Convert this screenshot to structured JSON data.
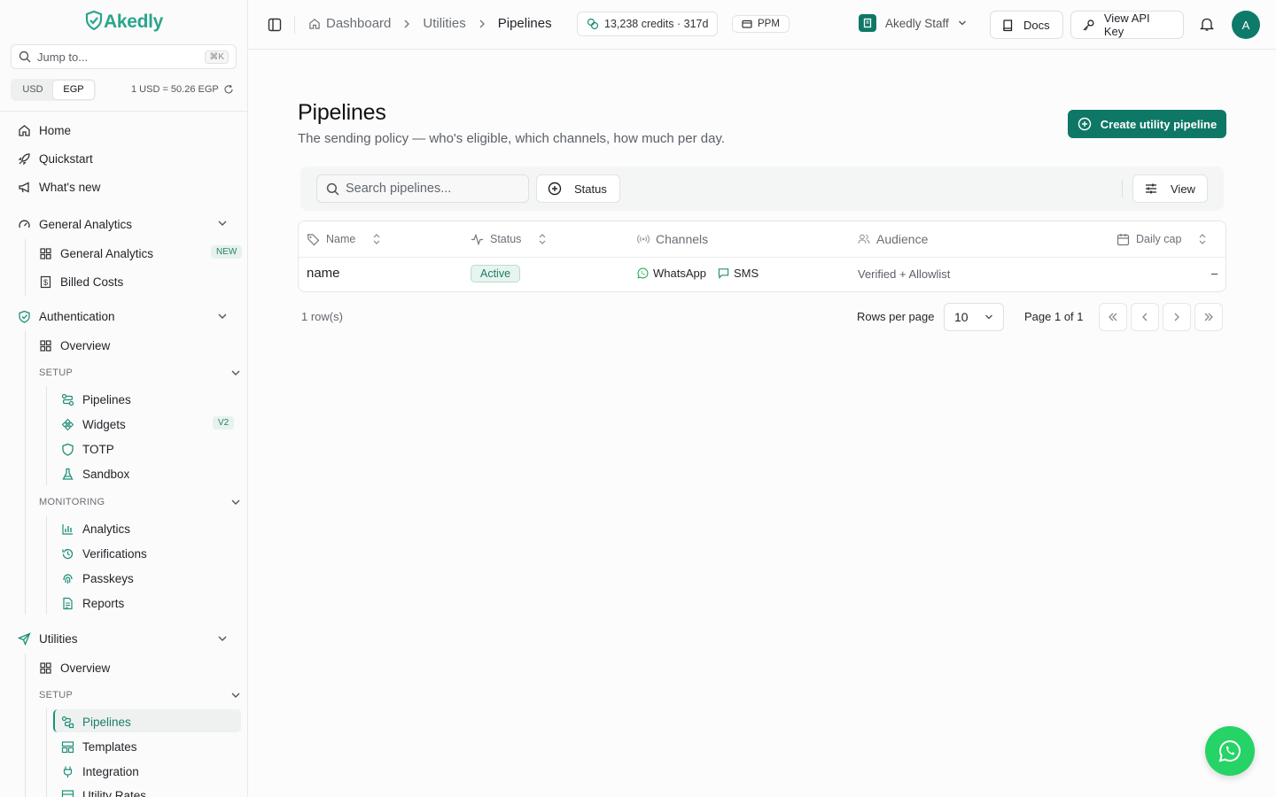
{
  "app": {
    "brand": "Akedly",
    "brand_color": "#2aa58c",
    "accent": "#0f7766"
  },
  "sidebar": {
    "jump_placeholder": "Jump to...",
    "jump_shortcut": "⌘K",
    "currency": {
      "options": [
        "USD",
        "EGP"
      ],
      "selected": "EGP",
      "rate": "1 USD = 50.26 EGP"
    },
    "top_items": [
      {
        "label": "Home",
        "icon": "home-icon"
      },
      {
        "label": "Quickstart",
        "icon": "rocket-icon"
      },
      {
        "label": "What's new",
        "icon": "megaphone-icon"
      }
    ],
    "general_analytics": {
      "label": "General Analytics",
      "items": [
        {
          "label": "General Analytics",
          "badge": "NEW"
        },
        {
          "label": "Billed Costs"
        }
      ]
    },
    "authentication": {
      "label": "Authentication",
      "overview": "Overview",
      "setup_label": "SETUP",
      "setup_items": [
        {
          "label": "Pipelines"
        },
        {
          "label": "Widgets",
          "badge": "V2"
        },
        {
          "label": "TOTP"
        },
        {
          "label": "Sandbox"
        }
      ],
      "monitoring_label": "MONITORING",
      "monitoring_items": [
        {
          "label": "Analytics"
        },
        {
          "label": "Verifications"
        },
        {
          "label": "Passkeys"
        },
        {
          "label": "Reports"
        }
      ]
    },
    "utilities": {
      "label": "Utilities",
      "overview": "Overview",
      "setup_label": "SETUP",
      "setup_items": [
        {
          "label": "Pipelines",
          "active": true
        },
        {
          "label": "Templates"
        },
        {
          "label": "Integration"
        },
        {
          "label": "Utility Rates"
        }
      ]
    }
  },
  "header": {
    "breadcrumb": [
      "Dashboard",
      "Utilities",
      "Pipelines"
    ],
    "credits": "13,238 credits · 317d",
    "plan": "PPM",
    "org": "Akedly Staff",
    "docs": "Docs",
    "api_key": "View API Key",
    "avatar_initial": "A"
  },
  "main": {
    "title": "Pipelines",
    "subtitle": "The sending policy — who's eligible, which channels, how much per day.",
    "create_button": "Create utility pipeline",
    "search_placeholder": "Search pipelines...",
    "status_filter": "Status",
    "view_button": "View",
    "columns": [
      "Name",
      "Status",
      "Channels",
      "Audience",
      "Daily cap"
    ],
    "rows": [
      {
        "name": "name",
        "status": "Active",
        "channels": [
          "WhatsApp",
          "SMS"
        ],
        "audience": "Verified + Allowlist",
        "daily_cap": "–"
      }
    ],
    "row_count": "1 row(s)",
    "rows_per_page_label": "Rows per page",
    "rows_per_page": "10",
    "page_info": "Page 1 of 1"
  }
}
